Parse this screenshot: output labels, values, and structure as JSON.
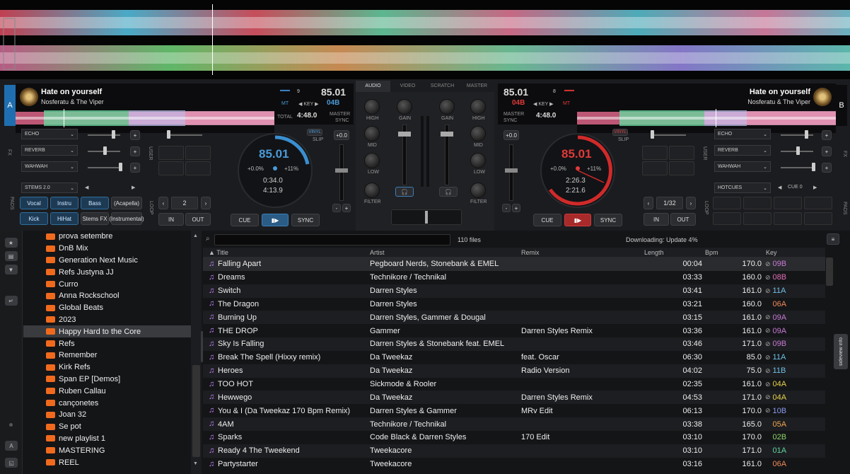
{
  "deck_a": {
    "letter": "A",
    "title": "Hate on yourself",
    "artist": "Nosferatu & The Viper",
    "key_num": "9",
    "bpm": "85.01",
    "mt": "MT",
    "key_label": "KEY",
    "key": "04B",
    "total_label": "TOTAL",
    "total": "4:48.0",
    "master_label": "MASTER",
    "sync_label": "SYNC",
    "jog_bpm": "85.01",
    "pitch": "+0.0%",
    "range": "+11%",
    "elapsed": "0:34.0",
    "remain": "4:13.9",
    "fx": [
      "ECHO",
      "REVERB",
      "WAHWAH"
    ],
    "fx_label": "FX",
    "user_label": "USER",
    "pads_label": "PADS",
    "stems_select": "STEMS 2.0",
    "stems": [
      "Vocal",
      "Instru",
      "Bass",
      "(Acapella)",
      "Kick",
      "HiHat",
      "Stems FX",
      "(Instrumental)"
    ],
    "loop_label": "LOOP",
    "loop_size": "2",
    "in": "IN",
    "out": "OUT",
    "cue": "CUE",
    "play": "▮▶",
    "sync": "SYNC",
    "pitch_val": "+0.0",
    "slip": "SLIP",
    "vinyl": "VINYL"
  },
  "deck_b": {
    "letter": "B",
    "title": "Hate on yourself",
    "artist": "Nosferatu & The Viper",
    "key_num": "8",
    "bpm": "85.01",
    "key": "04B",
    "key_label": "KEY",
    "mt": "MT",
    "total": "4:48.0",
    "master_label": "MASTER",
    "sync_label": "SYNC",
    "jog_bpm": "85.01",
    "pitch": "+0.0%",
    "range": "+11%",
    "elapsed": "2:26.3",
    "remain": "2:21.6",
    "fx": [
      "ECHO",
      "REVERB",
      "WAHWAH"
    ],
    "fx_label": "FX",
    "user_label": "USER",
    "pads_label": "PADS",
    "hotcues_select": "HOTCUES",
    "cue_label": "CUE 0",
    "loop_label": "LOOP",
    "loop_size": "1/32",
    "in": "IN",
    "out": "OUT",
    "cue": "CUE",
    "play": "▮▶",
    "sync": "SYNC",
    "pitch_val": "+0.0",
    "slip": "SLIP",
    "vinyl": "VINYL"
  },
  "mixer": {
    "tabs": [
      "AUDIO",
      "VIDEO",
      "SCRATCH",
      "MASTER"
    ],
    "high": "HIGH",
    "mid": "MID",
    "low": "LOW",
    "filter": "FILTER",
    "gain": "GAIN"
  },
  "browser": {
    "file_count": "110 files",
    "status": "Downloading: Update 4%",
    "folders_tab": "folders",
    "sideview_tab": "sideview",
    "info_tab": "info",
    "columns": {
      "title": "Title",
      "artist": "Artist",
      "remix": "Remix",
      "length": "Length",
      "bpm": "Bpm",
      "key": "Key"
    },
    "folders": [
      "prova setembre",
      "DnB Mix",
      "Generation Next Music",
      "Refs Justyna JJ",
      "Curro",
      "Anna Rockschool",
      "Global Beats",
      "2023",
      "Happy Hard to the Core",
      "Refs",
      "Remember",
      "Kirk Refs",
      "Span EP [Demos]",
      "Ruben Callau",
      "cançonetes",
      "Joan 32",
      "Se pot",
      "new playlist 1",
      "MASTERING",
      "REEL"
    ],
    "tracks": [
      {
        "title": "Falling Apart",
        "artist": "Pegboard Nerds, Stonebank & EMEL",
        "remix": "",
        "length": "00:04",
        "bpm": "170.0",
        "key": "09B",
        "key_color": "#c879d6",
        "check": true
      },
      {
        "title": "Dreams",
        "artist": "Technikore / Technikal",
        "remix": "",
        "length": "03:33",
        "bpm": "160.0",
        "key": "08B",
        "key_color": "#e06fb5",
        "check": true
      },
      {
        "title": "Switch",
        "artist": "Darren Styles",
        "remix": "",
        "length": "03:41",
        "bpm": "161.0",
        "key": "11A",
        "key_color": "#6fc0e8",
        "check": true
      },
      {
        "title": "The Dragon",
        "artist": "Darren Styles",
        "remix": "",
        "length": "03:21",
        "bpm": "160.0",
        "key": "06A",
        "key_color": "#f08a5a",
        "check": false
      },
      {
        "title": "Burning Up",
        "artist": "Darren Styles, Gammer & Dougal",
        "remix": "",
        "length": "03:15",
        "bpm": "161.0",
        "key": "09A",
        "key_color": "#c879d6",
        "check": true
      },
      {
        "title": "THE DROP",
        "artist": "Gammer",
        "remix": "Darren Styles Remix",
        "length": "03:36",
        "bpm": "161.0",
        "key": "09A",
        "key_color": "#c879d6",
        "check": true
      },
      {
        "title": "Sky Is Falling",
        "artist": "Darren Styles & Stonebank feat. EMEL",
        "remix": "",
        "length": "03:46",
        "bpm": "171.0",
        "key": "09B",
        "key_color": "#c879d6",
        "check": true
      },
      {
        "title": "Break The Spell (Hixxy remix)",
        "artist": "Da Tweekaz",
        "remix": "feat. Oscar",
        "length": "06:30",
        "bpm": "85.0",
        "key": "11A",
        "key_color": "#6fc0e8",
        "check": true
      },
      {
        "title": "Heroes",
        "artist": "Da Tweekaz",
        "remix": "Radio Version",
        "length": "04:02",
        "bpm": "75.0",
        "key": "11B",
        "key_color": "#6fc0e8",
        "check": true
      },
      {
        "title": "TOO HOT",
        "artist": "Sickmode & Rooler",
        "remix": "",
        "length": "02:35",
        "bpm": "161.0",
        "key": "04A",
        "key_color": "#e8d24a",
        "check": true
      },
      {
        "title": "Hewwego",
        "artist": "Da Tweekaz",
        "remix": "Darren Styles Remix",
        "length": "04:53",
        "bpm": "171.0",
        "key": "04A",
        "key_color": "#e8d24a",
        "check": true
      },
      {
        "title": "You & I (Da Tweekaz 170 Bpm Remix)",
        "artist": "Darren Styles & Gammer",
        "remix": "MRv Edit",
        "length": "06:13",
        "bpm": "170.0",
        "key": "10B",
        "key_color": "#8a9cf0",
        "check": true
      },
      {
        "title": "4AM",
        "artist": "Technikore / Technikal",
        "remix": "",
        "length": "03:38",
        "bpm": "165.0",
        "key": "05A",
        "key_color": "#f0a650",
        "check": false
      },
      {
        "title": "Sparks",
        "artist": "Code Black & Darren Styles",
        "remix": "170 Edit",
        "length": "03:10",
        "bpm": "170.0",
        "key": "02B",
        "key_color": "#8ed36a",
        "check": false
      },
      {
        "title": "Ready 4 The Tweekend",
        "artist": "Tweekacore",
        "remix": "",
        "length": "03:10",
        "bpm": "171.0",
        "key": "01A",
        "key_color": "#5fd6a0",
        "check": false
      },
      {
        "title": "Partystarter",
        "artist": "Tweekacore",
        "remix": "",
        "length": "03:16",
        "bpm": "161.0",
        "key": "06A",
        "key_color": "#f08a5a",
        "check": false
      }
    ]
  }
}
